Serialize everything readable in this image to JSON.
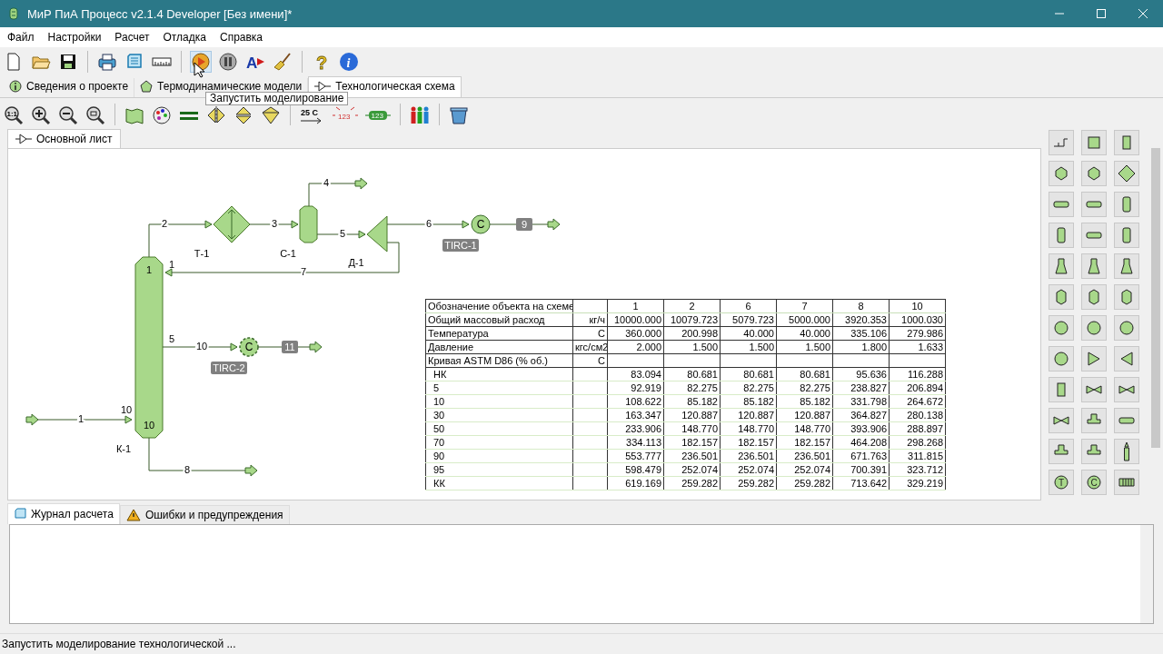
{
  "window": {
    "title": "МиР ПиА Процесс v2.1.4 Developer [Без имени]*"
  },
  "menu": [
    "Файл",
    "Настройки",
    "Расчет",
    "Отладка",
    "Справка"
  ],
  "toolbar": {
    "text_tool": "A",
    "help": "?",
    "info": "i"
  },
  "tooltip": {
    "text": "Запустить моделирование"
  },
  "tabs": [
    {
      "label": "Сведения о проекте",
      "selected": false
    },
    {
      "label": "Термодинамические модели",
      "selected": false
    },
    {
      "label": "Технологическая схема",
      "selected": true
    }
  ],
  "toolbar2": {
    "zoom_actual": "1:1",
    "temperature": "25 C",
    "hidden_values": "123",
    "show_values": "123"
  },
  "sheet_tabs": [
    {
      "label": "Основной лист",
      "selected": true
    }
  ],
  "diagram": {
    "units": [
      {
        "kind": "column",
        "name": "К-1",
        "top_stage": "1",
        "bottom_stage": "10"
      },
      {
        "kind": "heat_exchanger",
        "name": "Т-1"
      },
      {
        "kind": "separator",
        "name": "С-1"
      },
      {
        "kind": "splitter",
        "name": "Д-1"
      }
    ],
    "streams": [
      {
        "label": "1"
      },
      {
        "label": "2"
      },
      {
        "label": "3"
      },
      {
        "label": "4"
      },
      {
        "label": "5"
      },
      {
        "label": "6"
      },
      {
        "label": "7"
      },
      {
        "label": "10"
      },
      {
        "label": "8"
      }
    ],
    "stage_labels": [
      "10",
      "1",
      "5"
    ],
    "controllers": [
      {
        "symbol": "C",
        "tag": "TIRC-1",
        "badge": "9",
        "dashed": false
      },
      {
        "symbol": "C",
        "tag": "TIRC-2",
        "badge": "11",
        "dashed": true
      }
    ]
  },
  "table": {
    "columns": [
      "Обозначение объекта на схеме",
      "",
      "1",
      "2",
      "6",
      "7",
      "8",
      "10"
    ],
    "rows": [
      {
        "kind": "main",
        "name": "Общий массовый расход",
        "unit": "кг/ч",
        "values": [
          "10000.000",
          "10079.723",
          "5079.723",
          "5000.000",
          "3920.353",
          "1000.030"
        ]
      },
      {
        "kind": "main",
        "name": "Температура",
        "unit": "С",
        "values": [
          "360.000",
          "200.998",
          "40.000",
          "40.000",
          "335.106",
          "279.986"
        ]
      },
      {
        "kind": "main",
        "name": "Давление",
        "unit": "кгс/см2",
        "values": [
          "2.000",
          "1.500",
          "1.500",
          "1.500",
          "1.800",
          "1.633"
        ]
      },
      {
        "kind": "main",
        "name": "Кривая ASTM D86 (% об.)",
        "unit": "С"
      },
      {
        "kind": "sub",
        "name": "НК",
        "unit": "",
        "values": [
          "83.094",
          "80.681",
          "80.681",
          "80.681",
          "95.636",
          "116.288"
        ]
      },
      {
        "kind": "sub",
        "name": "5",
        "unit": "",
        "values": [
          "92.919",
          "82.275",
          "82.275",
          "82.275",
          "238.827",
          "206.894"
        ]
      },
      {
        "kind": "sub",
        "name": "10",
        "unit": "",
        "values": [
          "108.622",
          "85.182",
          "85.182",
          "85.182",
          "331.798",
          "264.672"
        ]
      },
      {
        "kind": "sub",
        "name": "30",
        "unit": "",
        "values": [
          "163.347",
          "120.887",
          "120.887",
          "120.887",
          "364.827",
          "280.138"
        ]
      },
      {
        "kind": "sub",
        "name": "50",
        "unit": "",
        "values": [
          "233.906",
          "148.770",
          "148.770",
          "148.770",
          "393.906",
          "288.897"
        ]
      },
      {
        "kind": "sub",
        "name": "70",
        "unit": "",
        "values": [
          "334.113",
          "182.157",
          "182.157",
          "182.157",
          "464.208",
          "298.268"
        ]
      },
      {
        "kind": "sub",
        "name": "90",
        "unit": "",
        "values": [
          "553.777",
          "236.501",
          "236.501",
          "236.501",
          "671.763",
          "311.815"
        ]
      },
      {
        "kind": "sub",
        "name": "95",
        "unit": "",
        "values": [
          "598.479",
          "252.074",
          "252.074",
          "252.074",
          "700.391",
          "323.712"
        ]
      },
      {
        "kind": "sub",
        "name": "КК",
        "unit": "",
        "values": [
          "619.169",
          "259.282",
          "259.282",
          "259.282",
          "713.642",
          "329.219"
        ]
      }
    ]
  },
  "palette": {
    "glyphs": [
      "T",
      "C"
    ]
  },
  "bottom_tabs": [
    {
      "label": "Журнал расчета",
      "selected": true
    },
    {
      "label": "Ошибки и предупреждения",
      "selected": false
    }
  ],
  "status_bar": {
    "text": "Запустить моделирование технологической ..."
  }
}
